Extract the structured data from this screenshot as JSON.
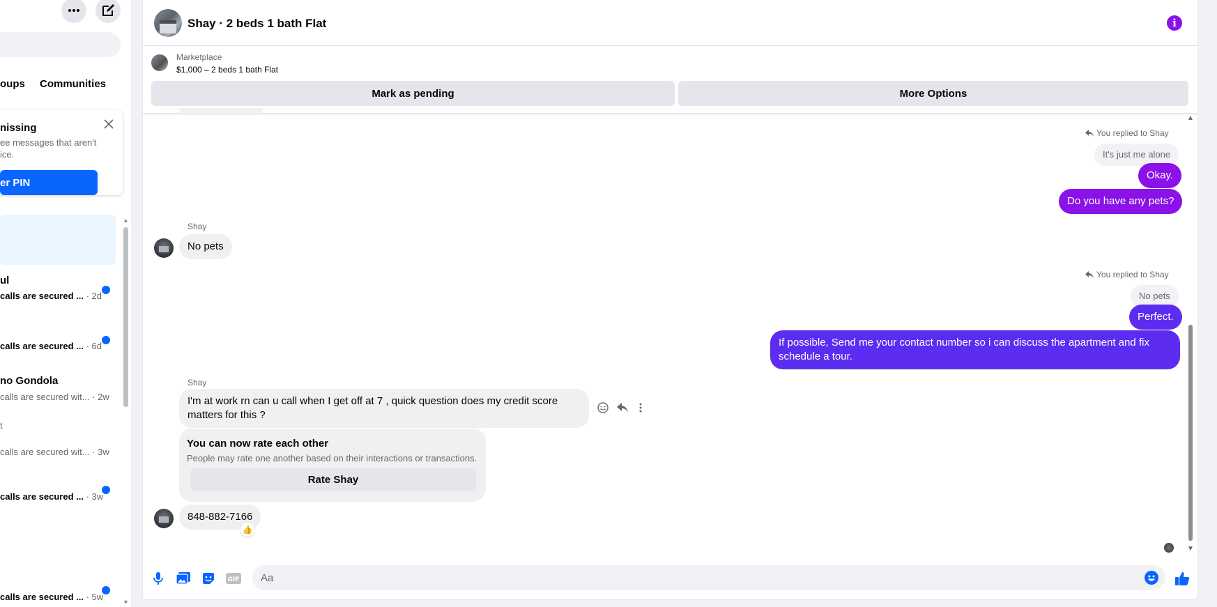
{
  "sidebar": {
    "tabs": [
      "oups",
      "Communities"
    ],
    "pin_card": {
      "title": "nissing",
      "body_line1": "ee messages that aren't",
      "body_line2": "ice.",
      "button": "er PIN"
    },
    "conversations": [
      {
        "name": "ul",
        "snippet": "calls are secured ...",
        "time": " · 2d",
        "unread": true
      },
      {
        "name": "",
        "snippet": "calls are secured ...",
        "time": " · 6d",
        "unread": true
      },
      {
        "name": "no Gondola",
        "snippet": "calls are secured wit...",
        "time": " · 2w",
        "unread": false
      },
      {
        "name": "t",
        "snippet": "calls are secured wit...",
        "time": " · 3w",
        "unread": false
      },
      {
        "name": "",
        "snippet": "calls are secured ...",
        "time": " · 3w",
        "unread": true
      },
      {
        "name": "",
        "snippet": "calls are secured ...",
        "time": " · 5w",
        "unread": true
      }
    ]
  },
  "chat": {
    "title": "Shay · 2 beds 1 bath Flat",
    "marketplace": {
      "label": "Marketplace",
      "listing": "$1,000 – 2 beds 1 bath Flat",
      "mark_pending": "Mark as pending",
      "more_options": "More Options"
    },
    "messages": {
      "reply1_meta": "You replied to Shay",
      "reply1_quote": "It's just me alone",
      "out_okay": "Okay.",
      "out_pets": "Do you have any pets?",
      "sender1": "Shay",
      "in_no_pets": "No pets",
      "reply2_meta": "You replied to Shay",
      "reply2_quote": "No pets",
      "out_perfect": "Perfect.",
      "out_contact_line1": "If possible, Send me your contact number so i can discuss the apartment and fix",
      "out_contact_line2": "schedule a tour.",
      "sender2": "Shay",
      "in_work_line1": "I'm at work rn can u call when I get off at 7 , quick question does my credit score",
      "in_work_line2": "matters for this ?",
      "rate_title": "You can now rate each other",
      "rate_sub": "People may rate one another based on their interactions or transactions.",
      "rate_button": "Rate Shay",
      "in_phone": "848-882-7166",
      "reaction": "👍"
    },
    "composer": {
      "placeholder": "Aa"
    }
  },
  "colors": {
    "outgoing_purple": "#8a12e8",
    "outgoing_indigo": "#5c2df0",
    "accent_blue": "#0866ff",
    "unread_dot": "#0866ff"
  },
  "icons": [
    "more-icon",
    "compose-icon",
    "close-icon",
    "info-icon",
    "reply-icon",
    "emoji-icon",
    "more-vertical-icon",
    "microphone-icon",
    "photo-icon",
    "sticker-icon",
    "gif-icon",
    "emoji-picker-icon",
    "thumbs-up-icon"
  ]
}
